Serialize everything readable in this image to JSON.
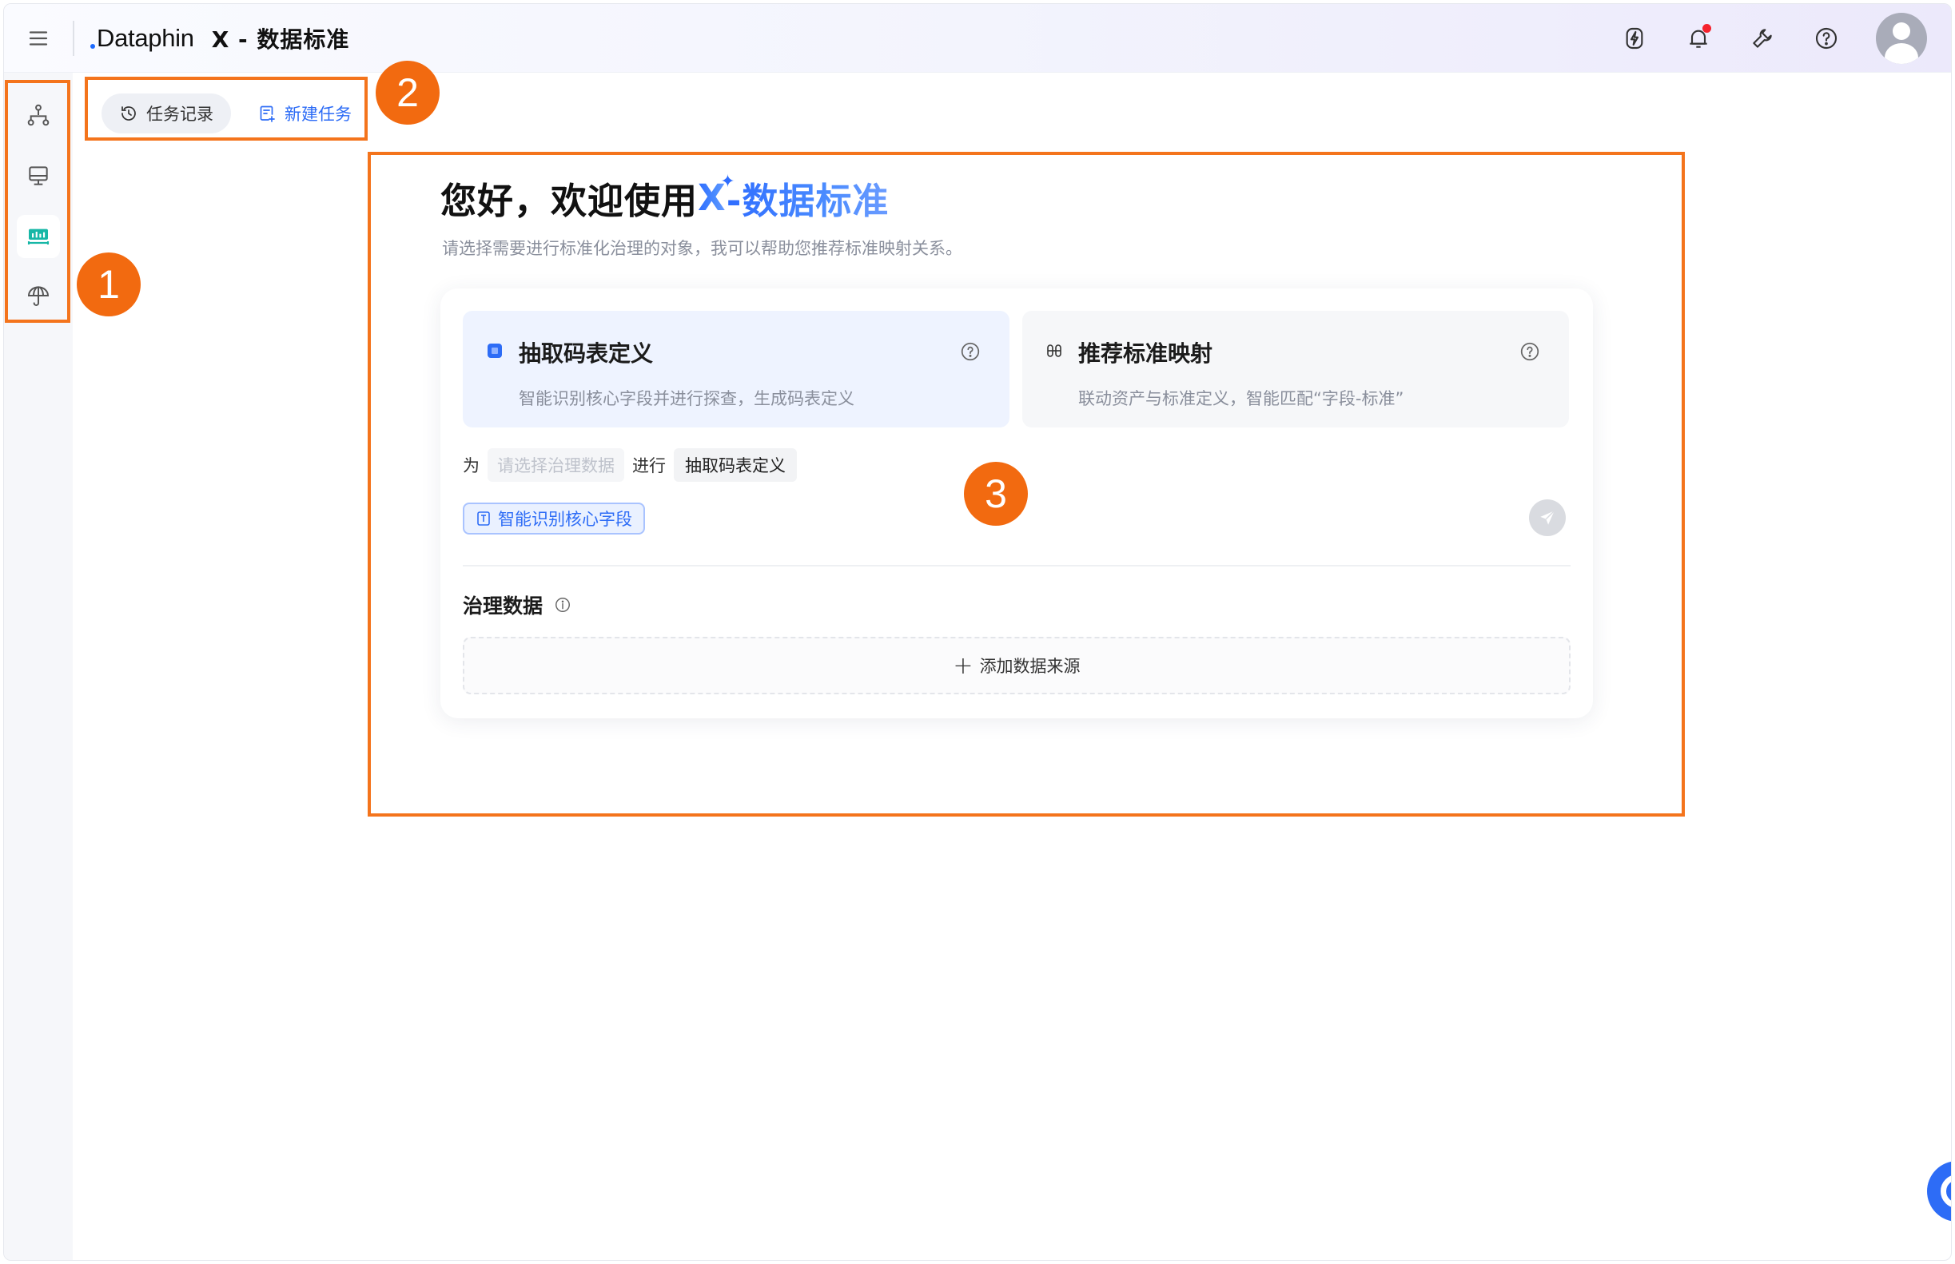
{
  "header": {
    "brand": "Dataphin",
    "product": "X - 数据标准",
    "icons": [
      "menu-icon",
      "lightning-icon",
      "bell-icon",
      "wrench-icon",
      "help-icon",
      "avatar"
    ]
  },
  "leftrail": {
    "items": [
      "org-tree-icon",
      "monitor-icon",
      "standard-icon",
      "umbrella-icon"
    ],
    "active_index": 2
  },
  "tabs": {
    "history_label": "任务记录",
    "new_label": "新建任务"
  },
  "main": {
    "title_prefix": "您好，欢迎使用 ",
    "title_x": "X",
    "title_suffix": "-数据标准",
    "subtitle": "请选择需要进行标准化治理的对象，我可以帮助您推荐标准映射关系。",
    "options": [
      {
        "title": "抽取码表定义",
        "desc": "智能识别核心字段并进行探查，生成码表定义",
        "selected": true
      },
      {
        "title": "推荐标准映射",
        "desc": "联动资产与标准定义，智能匹配“字段-标准”",
        "selected": false
      }
    ],
    "sentence": {
      "prefix": "为",
      "placeholder": "请选择治理数据",
      "middle": "进行",
      "value": "抽取码表定义"
    },
    "smart_tag": "智能识别核心字段",
    "section_title": "治理数据",
    "add_source": "添加数据来源"
  },
  "annotations": {
    "badge1": "1",
    "badge2": "2",
    "badge3": "3",
    "color": "#f4741c"
  },
  "colors": {
    "accent": "#2d6cf6",
    "annotation": "#f26a10"
  }
}
